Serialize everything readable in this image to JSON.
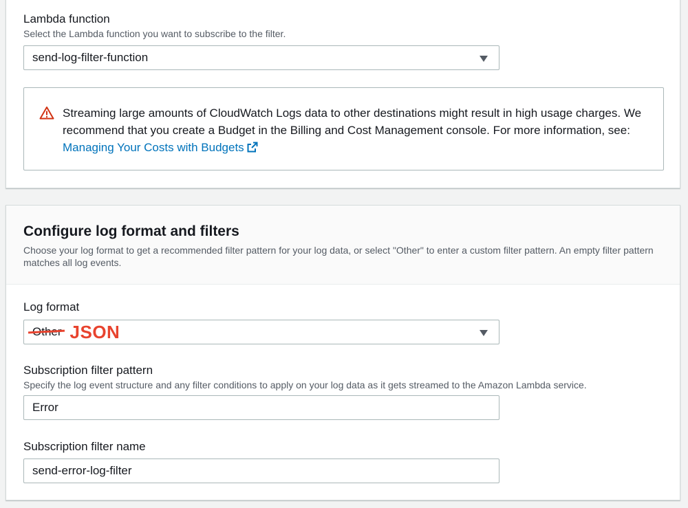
{
  "lambda_section": {
    "label": "Lambda function",
    "description": "Select the Lambda function you want to subscribe to the filter.",
    "selected_function": "send-log-filter-function",
    "alert": {
      "icon": "warning-icon",
      "text_line": "Streaming large amounts of CloudWatch Logs data to other destinations might result in high usage charges. We recommend that you create a Budget in the Billing and Cost Management console. For more information, see: ",
      "link_label": "Managing Your Costs with Budgets",
      "link_icon": "external-link-icon"
    }
  },
  "configure_section": {
    "title": "Configure log format and filters",
    "description": "Choose your log format to get a recommended filter pattern for your log data, or select \"Other\" to enter a custom filter pattern. An empty filter pattern matches all log events.",
    "log_format": {
      "label": "Log format",
      "selected_value": "Other",
      "annotation": "JSON"
    },
    "filter_pattern": {
      "label": "Subscription filter pattern",
      "description": "Specify the log event structure and any filter conditions to apply on your log data as it gets streamed to the Amazon Lambda service.",
      "value": "Error"
    },
    "filter_name": {
      "label": "Subscription filter name",
      "value": "send-error-log-filter"
    }
  },
  "colors": {
    "link": "#0073bb",
    "warning": "#d13212",
    "annotation": "#e8432e",
    "border": "#aab7b8"
  }
}
